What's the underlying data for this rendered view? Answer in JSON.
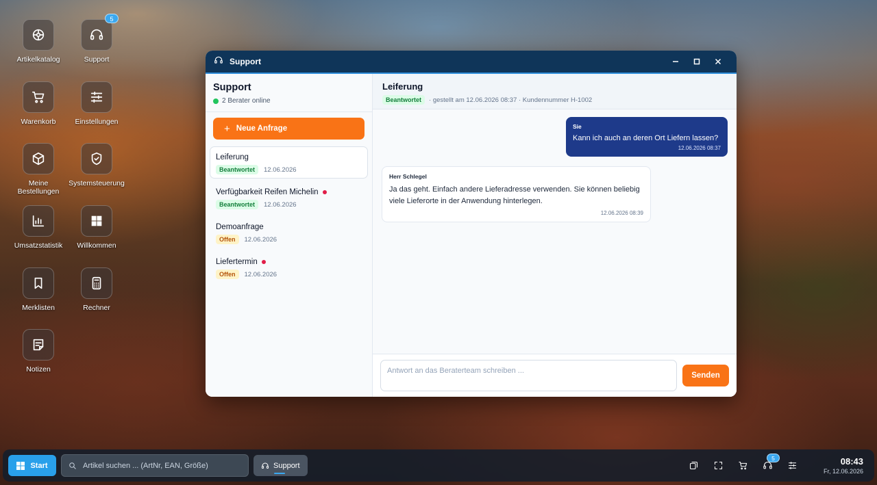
{
  "desktop": {
    "icons": [
      {
        "label": "Artikelkatalog",
        "icon": "katalog-icon"
      },
      {
        "label": "Support",
        "icon": "headset-icon",
        "badge": "5"
      },
      {
        "label": "Warenkorb",
        "icon": "cart-icon"
      },
      {
        "label": "Einstellungen",
        "icon": "sliders-icon"
      },
      {
        "label": "Meine Bestellungen",
        "icon": "box-icon"
      },
      {
        "label": "Systemsteuerung",
        "icon": "shield-icon"
      },
      {
        "label": "Umsatzstatistik",
        "icon": "bar-chart-icon"
      },
      {
        "label": "Willkommen",
        "icon": "windows-icon"
      },
      {
        "label": "Merklisten",
        "icon": "bookmark-icon"
      },
      {
        "label": "Rechner",
        "icon": "calculator-icon"
      },
      {
        "label": "Notizen",
        "icon": "notes-icon"
      }
    ]
  },
  "window": {
    "title": "Support",
    "sidebar": {
      "title": "Support",
      "online": "2 Berater online",
      "new_button": "Neue Anfrage",
      "tickets": [
        {
          "title": "Leiferung",
          "status": "Beantwortet",
          "date": "12.06.2026",
          "unread": false
        },
        {
          "title": "Verfügbarkeit Reifen Michelin",
          "status": "Beantwortet",
          "date": "12.06.2026",
          "unread": true
        },
        {
          "title": "Demoanfrage",
          "status": "Offen",
          "date": "12.06.2026",
          "unread": false
        },
        {
          "title": "Liefertermin",
          "status": "Offen",
          "date": "12.06.2026",
          "unread": true
        }
      ]
    },
    "chat": {
      "title": "Leiferung",
      "status": "Beantwortet",
      "meta": "· gestellt am 12.06.2026 08:37 · Kundennummer H-1002",
      "messages": [
        {
          "sender": "Sie",
          "text": "Kann ich auch an deren Ort Liefern lassen?",
          "time": "12.06.2026 08:37"
        },
        {
          "sender": "Herr Schlegel",
          "text": "Ja das geht. Einfach andere Lieferadresse verwenden. Sie können beliebig viele Lieferorte in der Anwendung hinterlegen.",
          "time": "12.06.2026 08:39"
        }
      ],
      "input_placeholder": "Antwort an das Beraterteam schreiben ...",
      "send_label": "Senden"
    }
  },
  "taskbar": {
    "start_label": "Start",
    "search_placeholder": "Artikel suchen ... (ArtNr, EAN, Größe)",
    "active_app": "Support",
    "support_badge": "5",
    "time": "08:43",
    "date": "Fr, 12.06.2026"
  },
  "colors": {
    "accent": "#f97316",
    "titlebar": "#0f3559",
    "outgoing_bubble": "#1e3a8a",
    "start_button": "#29a0ea"
  }
}
